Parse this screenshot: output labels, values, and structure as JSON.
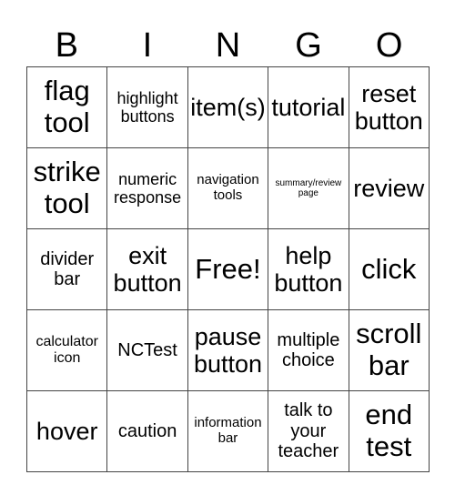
{
  "title_letters": [
    "B",
    "I",
    "N",
    "G",
    "O"
  ],
  "card": {
    "rows": [
      [
        "flag tool",
        "highlight buttons",
        "item(s)",
        "tutorial",
        "reset button"
      ],
      [
        "strike tool",
        "numeric response",
        "navigation tools",
        "summary/review page",
        "review"
      ],
      [
        "divider bar",
        "exit button",
        "Free!",
        "help button",
        "click"
      ],
      [
        "calculator icon",
        "NCTest",
        "pause button",
        "multiple choice",
        "scroll bar"
      ],
      [
        "hover",
        "caution",
        "information bar",
        "talk to your teacher",
        "end test"
      ]
    ]
  },
  "colors": {
    "grid_line": "#444444",
    "text": "#000000",
    "background": "#ffffff"
  }
}
